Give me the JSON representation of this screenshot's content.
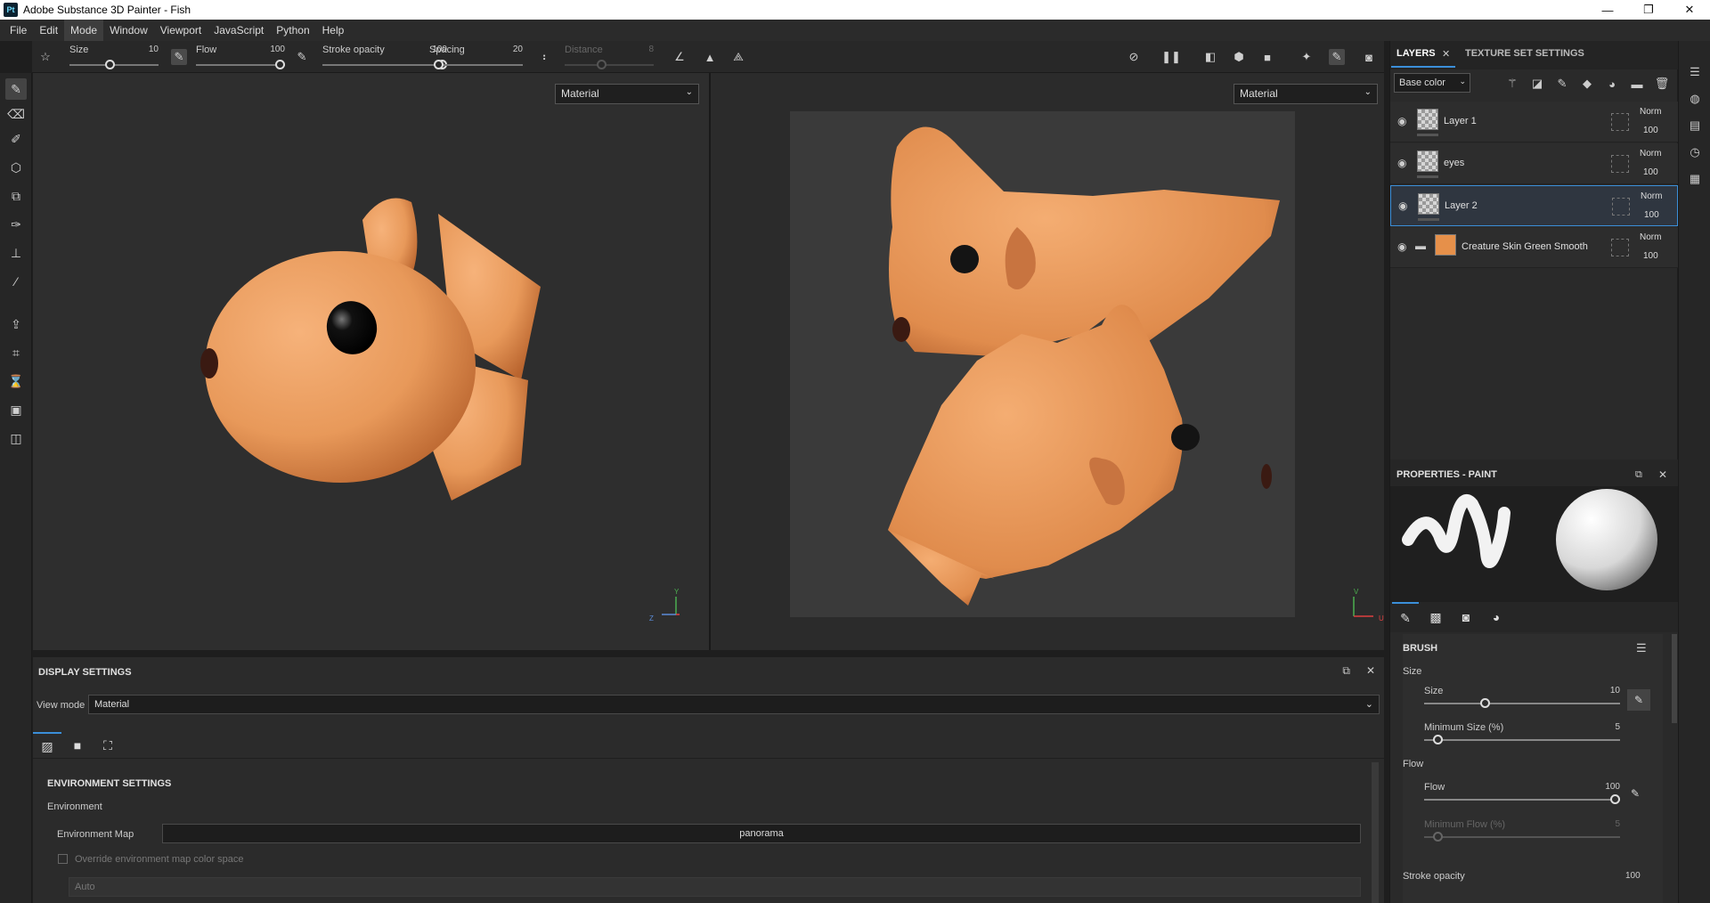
{
  "window": {
    "title": "Adobe Substance 3D Painter - Fish",
    "logo": "Pt",
    "minimize": "—",
    "maximize": "❐",
    "close": "✕"
  },
  "menu": [
    "File",
    "Edit",
    "Mode",
    "Window",
    "Viewport",
    "JavaScript",
    "Python",
    "Help"
  ],
  "tool_options": {
    "size": {
      "label": "Size",
      "value": "10",
      "level": 0.45
    },
    "flow": {
      "label": "Flow",
      "value": "100",
      "level": 1.0
    },
    "stroke_opacity": {
      "label": "Stroke opacity",
      "value": "100",
      "level": 1.0
    },
    "spacing": {
      "label": "Spacing",
      "value": "20",
      "level": 0.05
    },
    "distance": {
      "label": "Distance",
      "value": "8",
      "level": 0.4
    }
  },
  "viewports": {
    "left_mode": "Material",
    "right_mode": "Material",
    "axis_3d": {
      "y": "Y",
      "z": "Z"
    },
    "axis_uv": {
      "v": "V",
      "u": "U"
    }
  },
  "display_settings": {
    "title": "DISPLAY SETTINGS",
    "view_mode_label": "View mode",
    "view_mode": "Material",
    "section": "ENVIRONMENT SETTINGS",
    "environment_label": "Environment",
    "env_map_label": "Environment Map",
    "env_map_value": "panorama",
    "override_label": "Override environment map color space",
    "auto_value": "Auto"
  },
  "layers_panel": {
    "tab_layers": "LAYERS",
    "tab_texture": "TEXTURE SET SETTINGS",
    "channel": "Base color",
    "layers": [
      {
        "name": "Layer 1",
        "blend": "Norm",
        "opacity": "100"
      },
      {
        "name": "eyes",
        "blend": "Norm",
        "opacity": "100"
      },
      {
        "name": "Layer 2",
        "blend": "Norm",
        "opacity": "100"
      },
      {
        "name": "Creature Skin Green Smooth",
        "blend": "Norm",
        "opacity": "100"
      }
    ]
  },
  "properties": {
    "title": "PROPERTIES - PAINT",
    "brush_title": "BRUSH",
    "size_group": "Size",
    "size": {
      "label": "Size",
      "value": "10",
      "level": 0.3
    },
    "min_size": {
      "label": "Minimum Size (%)",
      "value": "5",
      "level": 0.05
    },
    "flow_group": "Flow",
    "flow": {
      "label": "Flow",
      "value": "100",
      "level": 1.0
    },
    "min_flow": {
      "label": "Minimum Flow (%)",
      "value": "5",
      "level": 0.05
    },
    "stroke_opacity": {
      "label": "Stroke opacity",
      "value": "100"
    }
  },
  "colors": {
    "accent": "#3b8fd9",
    "fish": "#e8995a",
    "material_swatch": "#e6904a"
  }
}
